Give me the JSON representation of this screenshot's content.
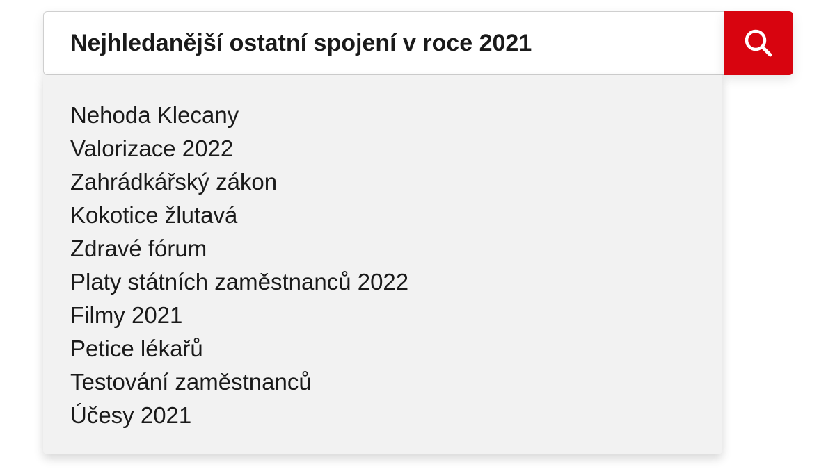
{
  "search": {
    "query": "Nejhledanější ostatní spojení v roce 2021",
    "button_icon": "search-icon",
    "accent_color": "#d8040f"
  },
  "suggestions": [
    "Nehoda Klecany",
    "Valorizace 2022",
    "Zahrádkářský zákon",
    "Kokotice žlutavá",
    "Zdravé fórum",
    "Platy státních zaměstnanců 2022",
    "Filmy 2021",
    "Petice lékařů",
    "Testování zaměstnanců",
    "Účesy 2021"
  ]
}
